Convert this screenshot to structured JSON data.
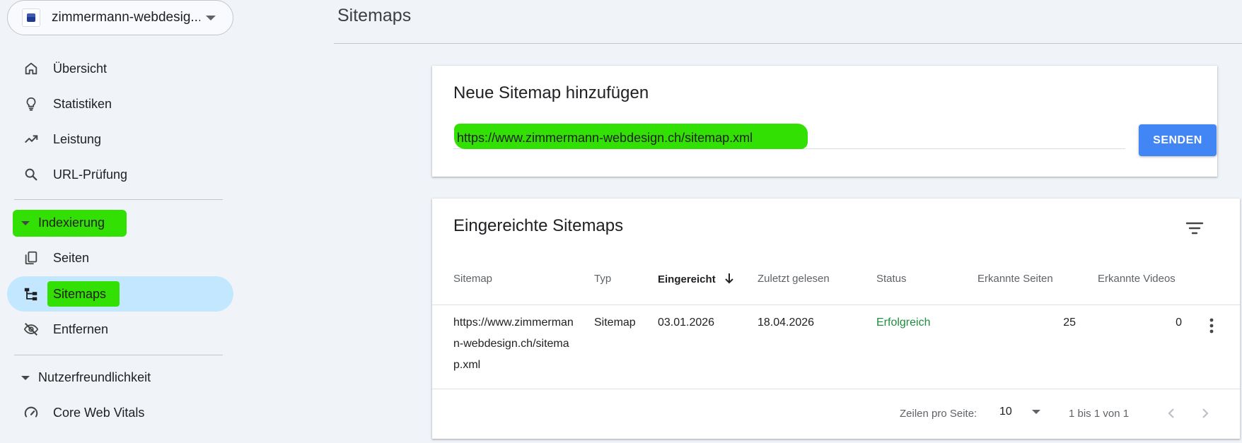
{
  "sidebar": {
    "property_name": "zimmermann-webdesig...",
    "items": [
      {
        "label": "Übersicht",
        "icon": "home-icon"
      },
      {
        "label": "Statistiken",
        "icon": "lightbulb-icon"
      },
      {
        "label": "Leistung",
        "icon": "trending-up-icon"
      },
      {
        "label": "URL-Prüfung",
        "icon": "search-icon"
      }
    ],
    "section_indexing": "Indexierung",
    "indexing_items": [
      {
        "label": "Seiten",
        "icon": "pages-icon"
      },
      {
        "label": "Sitemaps",
        "icon": "sitemap-icon",
        "active": true
      },
      {
        "label": "Entfernen",
        "icon": "visibility-off-icon"
      }
    ],
    "section_ux": "Nutzerfreundlichkeit",
    "ux_items": [
      {
        "label": "Core Web Vitals",
        "icon": "speed-gauge-icon"
      }
    ]
  },
  "main": {
    "title": "Sitemaps",
    "add_card": {
      "title": "Neue Sitemap hinzufügen",
      "url_value": "https://www.zimmermann-webdesign.ch/sitemap.xml",
      "send_label": "SENDEN"
    },
    "list_card": {
      "title": "Eingereichte Sitemaps",
      "columns": [
        "Sitemap",
        "Typ",
        "Eingereicht",
        "Zuletzt gelesen",
        "Status",
        "Erkannte Seiten",
        "Erkannte Videos"
      ],
      "rows": [
        {
          "sitemap": "https://www.zimmermann-webdesign.ch/sitemap.xml",
          "type": "Sitemap",
          "submitted": "03.01.2026",
          "last_read": "18.04.2026",
          "status": "Erfolgreich",
          "pages": "25",
          "videos": "0"
        }
      ],
      "rows_per_page_label": "Zeilen pro Seite:",
      "rows_per_page": "10",
      "range_text": "1 bis 1 von 1"
    }
  },
  "colors": {
    "accent": "#4285f4",
    "active_nav": "#c2e7ff",
    "highlight": "#33e003",
    "success": "#1e8e3e"
  }
}
